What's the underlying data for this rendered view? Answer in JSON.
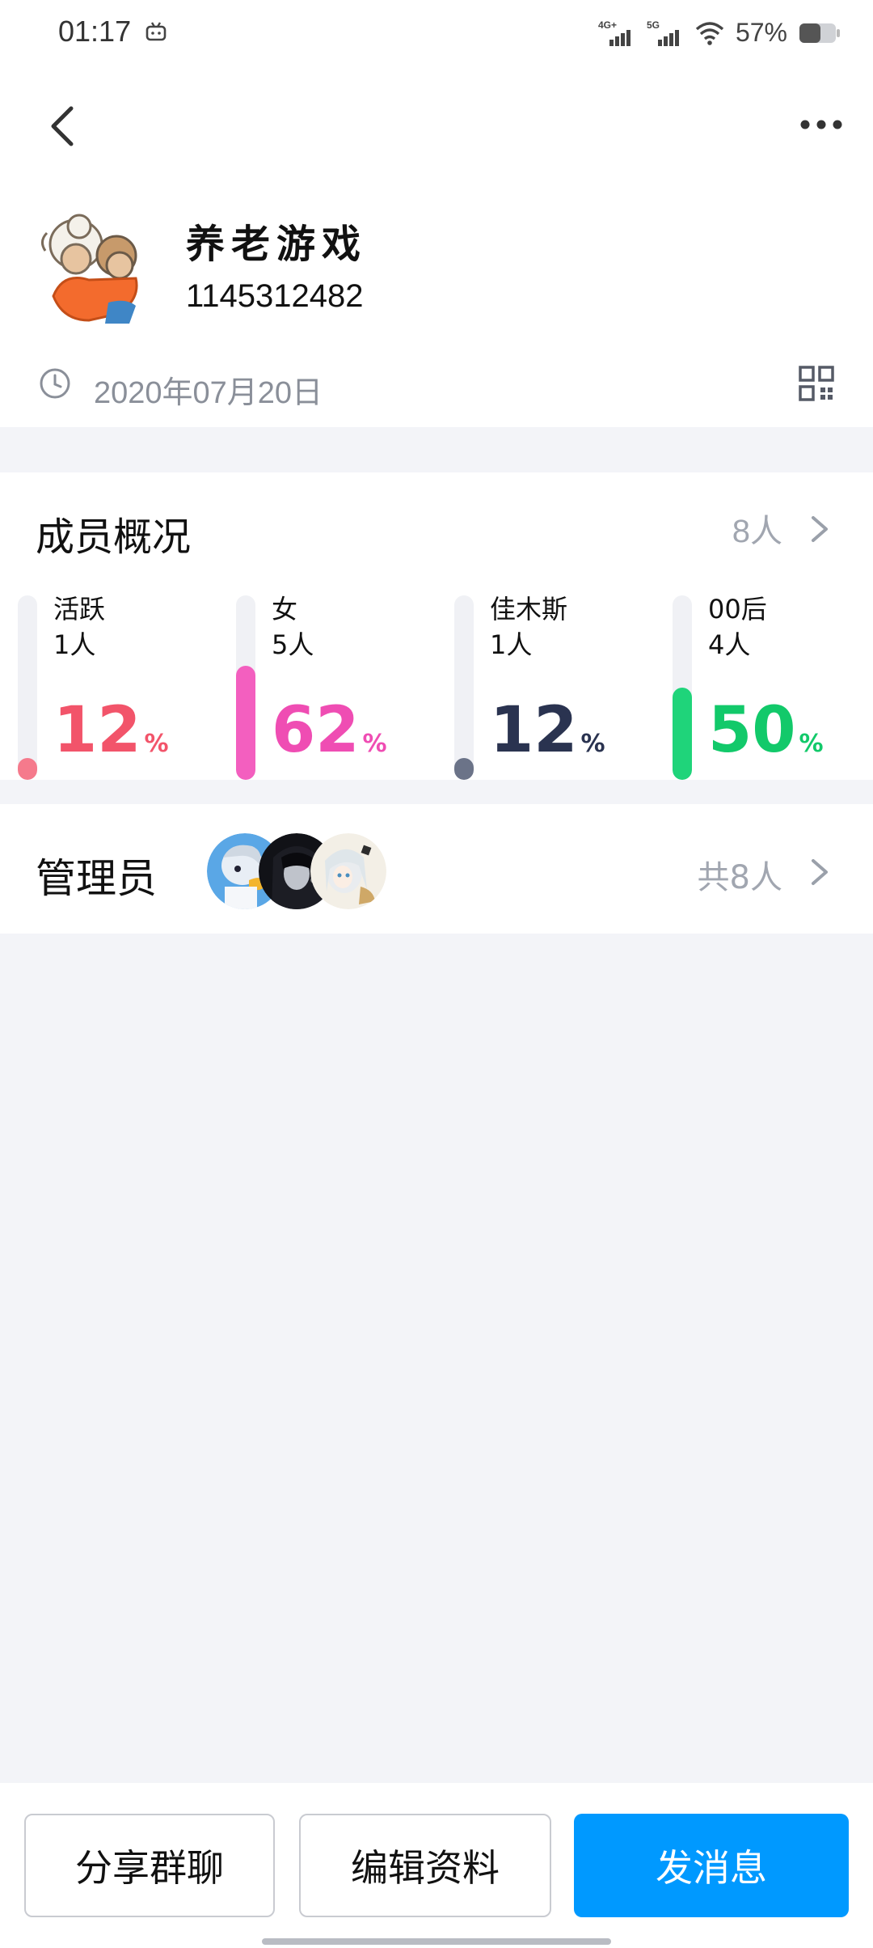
{
  "status_bar": {
    "time": "01:17",
    "network_1": "4G+",
    "network_2": "5G",
    "battery": "57%"
  },
  "header": {
    "back_icon": "chevron-left-icon",
    "more_icon": "more-dots-icon"
  },
  "group": {
    "name": "养老游戏",
    "id": "1145312482",
    "created_date": "2020年07月20日",
    "clock_icon": "clock-icon",
    "qr_icon": "qr-code-icon"
  },
  "members": {
    "title": "成员概况",
    "count": "8人",
    "stats": [
      {
        "label": "活跃",
        "count": "1人",
        "percent": "12",
        "percent_sign": "%",
        "fraction": 0.12,
        "color": "#f2546a",
        "fill_color": "#f57a8c"
      },
      {
        "label": "女",
        "count": "5人",
        "percent": "62",
        "percent_sign": "%",
        "fraction": 0.62,
        "color": "#ef4db3",
        "fill_color": "#f35fbf"
      },
      {
        "label": "佳木斯",
        "count": "1人",
        "percent": "12",
        "percent_sign": "%",
        "fraction": 0.12,
        "color": "#2a3350",
        "fill_color": "#6b7388"
      },
      {
        "label": "00后",
        "count": "4人",
        "percent": "50",
        "percent_sign": "%",
        "fraction": 0.5,
        "color": "#12c96a",
        "fill_color": "#1fd47a"
      }
    ]
  },
  "admins": {
    "title": "管理员",
    "count": "共8人"
  },
  "actions": {
    "share": "分享群聊",
    "edit": "编辑资料",
    "send": "发消息",
    "accent_color": "#0099ff"
  }
}
